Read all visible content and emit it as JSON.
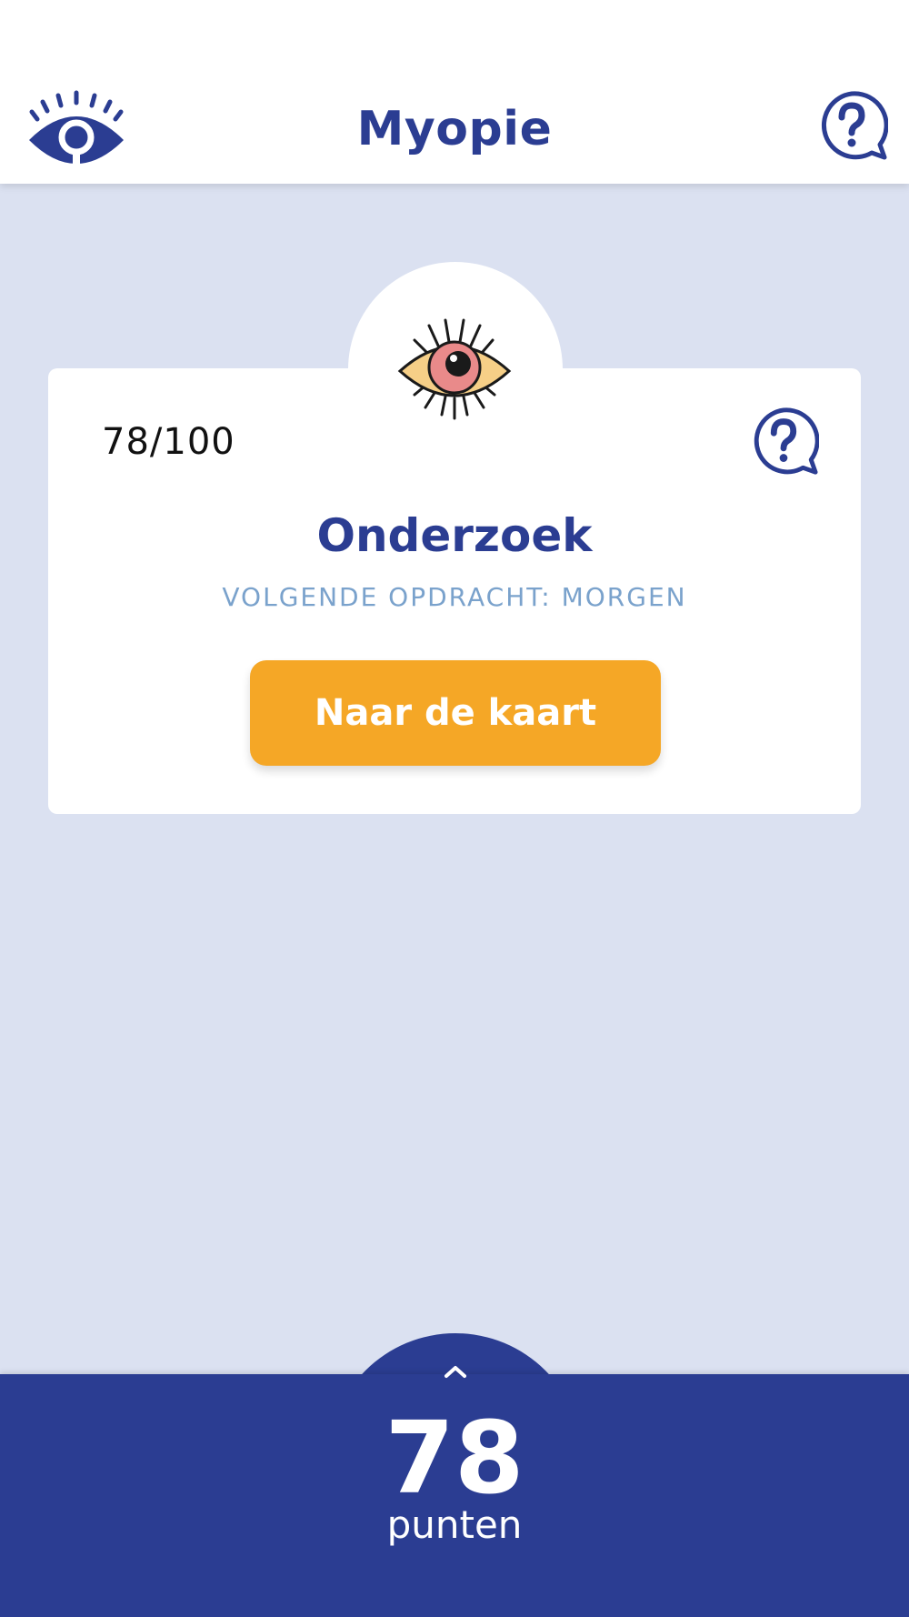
{
  "header": {
    "title": "Myopie",
    "logo_icon": "eye-logo-icon",
    "help_icon": "help-bubble-icon"
  },
  "card": {
    "score_fraction": "78/100",
    "title": "Onderzoek",
    "subtitle": "VOLGENDE OPDRACHT: MORGEN",
    "button_label": "Naar de kaart",
    "illustration_icon": "eye-illustration-icon",
    "help_icon": "help-bubble-icon"
  },
  "footer": {
    "points": "78",
    "points_label": "punten",
    "expand_icon": "chevron-up-icon"
  },
  "colors": {
    "brand_blue": "#2b3d92",
    "background": "#dbe1f1",
    "accent_orange": "#f5a726",
    "subtitle_blue": "#7aa2cc",
    "iris_pink": "#e98a8a",
    "eye_skin": "#f6cf87"
  }
}
